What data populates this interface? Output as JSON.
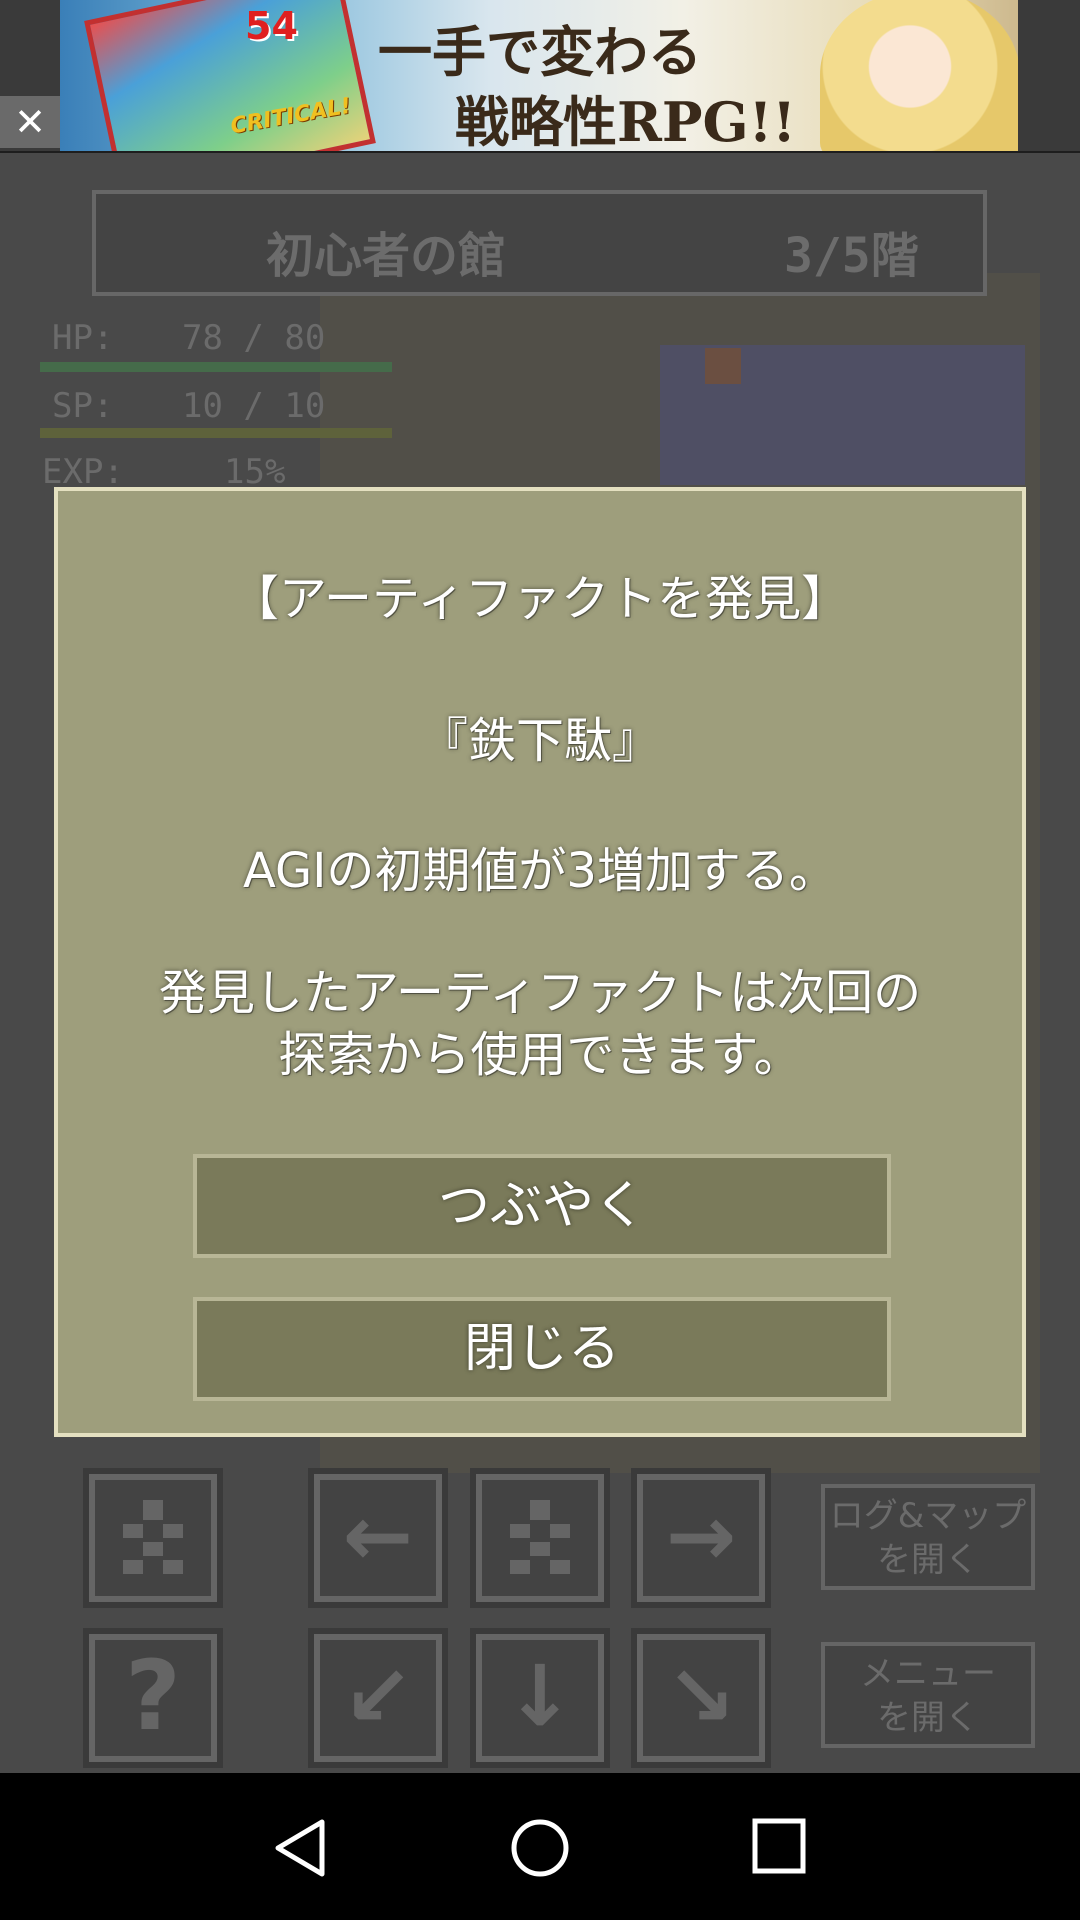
{
  "ad": {
    "close_label": "✕",
    "image_number": "54",
    "image_effect_text": "CRITICAL!",
    "headline_line1": "一手で変わる",
    "headline_line2": "戦略性RPG!!"
  },
  "game": {
    "location": "初心者の館",
    "floor": "3/5階",
    "stats": [
      {
        "label": "HP:",
        "value": "78 / 80"
      },
      {
        "label": "SP:",
        "value": "10 / 10"
      },
      {
        "label": "EXP:",
        "value": "15%"
      }
    ],
    "buttons": {
      "log_map": [
        "ログ&マップ",
        "を開く"
      ],
      "menu": [
        "メニュー",
        "を開く"
      ],
      "help_icon_glyph": "?",
      "arrows": {
        "left": "←",
        "right": "→",
        "down_left": "↙",
        "down": "↓",
        "down_right": "↘"
      }
    }
  },
  "dialog": {
    "title": "【アーティファクトを発見】",
    "item_name": "『鉄下駄』",
    "effect": "AGIの初期値が3増加する。",
    "note_line1": "発見したアーティファクトは次回の",
    "note_line2": "探索から使用できます。",
    "tweet_button": "つぶやく",
    "close_button": "閉じる"
  },
  "colors": {
    "dialog_bg": "#9e9e7c",
    "dialog_border": "#e4e0c0",
    "button_bg": "#7a7a5a",
    "hp_bar": "#4f7a55",
    "sp_bar": "#6b7044"
  },
  "navbar": {
    "icons": [
      "back-icon",
      "home-icon",
      "recents-icon"
    ]
  }
}
